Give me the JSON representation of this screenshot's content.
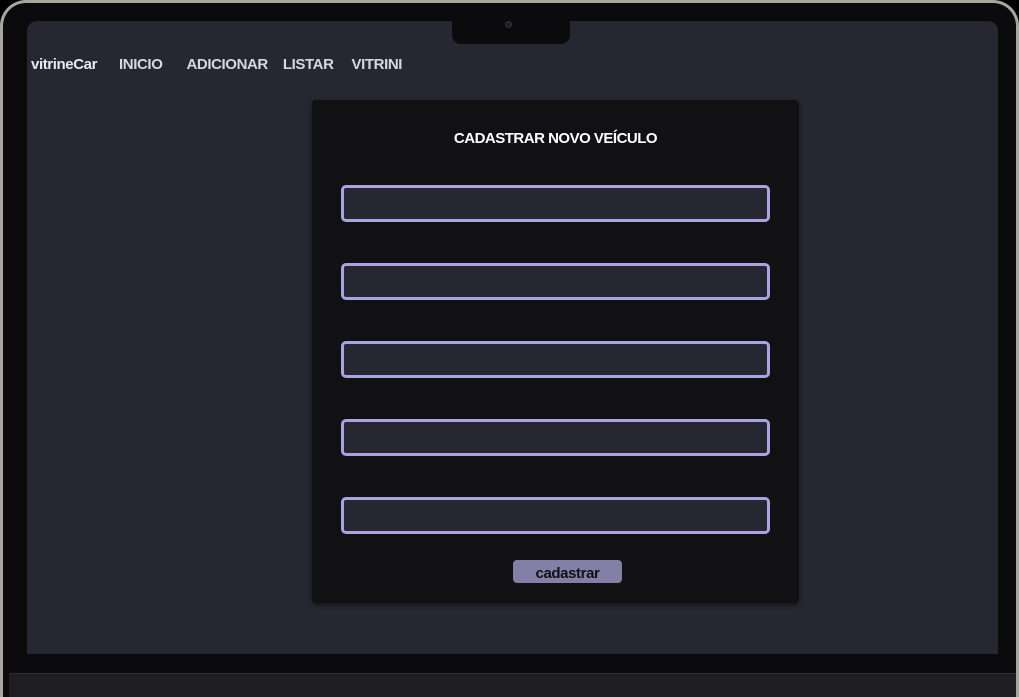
{
  "navbar": {
    "brand": "vitrineCar",
    "links": [
      "INICIO",
      "ADICIONAR",
      "LISTAR",
      "VITRINI"
    ]
  },
  "form": {
    "title": "CADASTRAR NOVO VEÍCULO",
    "fields": [
      {
        "value": "",
        "placeholder": ""
      },
      {
        "value": "",
        "placeholder": ""
      },
      {
        "value": "",
        "placeholder": ""
      },
      {
        "value": "",
        "placeholder": ""
      },
      {
        "value": "",
        "placeholder": ""
      }
    ],
    "submit_label": "cadastrar"
  },
  "colors": {
    "page_background": "#272731",
    "card_background": "#111013",
    "field_border": "#a9a3e2",
    "button_background": "#8380a8"
  }
}
